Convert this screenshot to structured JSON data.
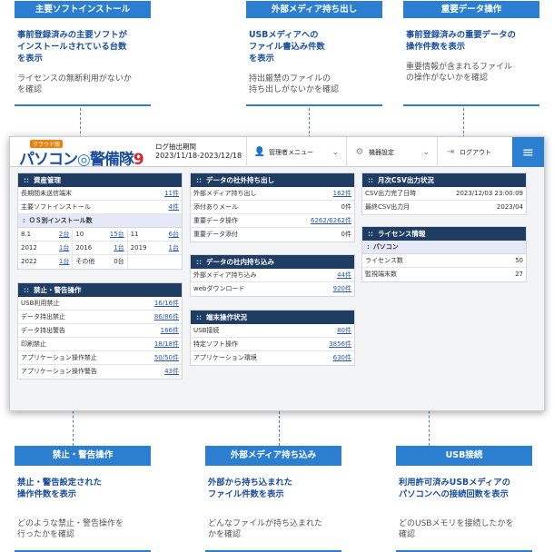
{
  "callouts_top": [
    {
      "header": "主要ソフトインストール",
      "desc": "事前登録済みの主要ソフトが\nインストールされている台数\nを表示",
      "note": "ライセンスの無断利用がないか\nを確認"
    },
    {
      "header": "外部メディア持ち出し",
      "desc": "USBメディアへの\nファイル書込み件数\nを表示",
      "note": "持出厳禁のファイルの\n持ち出しがないかを確認"
    },
    {
      "header": "重要データ操作",
      "desc": "事前登録済みの重要データの\n操作件数を表示",
      "note": "重要情報が含まれるファイル\nの操作がないかを確認"
    }
  ],
  "callouts_bottom": [
    {
      "header": "禁止・警告操作",
      "desc": "禁止・警告設定された\n操作件数を表示",
      "note": "どのような禁止・警告操作を\n行ったかを確認"
    },
    {
      "header": "外部メディア持ち込み",
      "desc": "外部から持ち込まれた\nファイル件数を表示",
      "note": "どんなファイルが持ち込まれた\nかを確認"
    },
    {
      "header": "USB接続",
      "desc": "利用許可済みUSBメディアの\nパソコンへの接続回数を表示",
      "note": "どのUSBメモリを接続したかを\n確認"
    }
  ],
  "app": {
    "logo_small": "クラウド版",
    "logo_main": "パソコン",
    "logo_sub": "警備隊",
    "logo_ver": "9",
    "period_label": "ログ抽出期間",
    "period_value": "2023/11/18-2023/12/18",
    "menu_admin": "管理者メニュー",
    "menu_device": "機器設定",
    "menu_logout": "ログアウト"
  },
  "panels": {
    "asset": {
      "title": "資産管理",
      "rows": [
        {
          "label": "長期間未送信端末",
          "value": "11件"
        },
        {
          "label": "主要ソフトインストール",
          "value": "4件"
        }
      ],
      "os_title": "ＯＳ別インストール数",
      "os_grid": [
        [
          {
            "k": "8.1",
            "v": "2台"
          },
          {
            "k": "10",
            "v": "15台"
          },
          {
            "k": "11",
            "v": "6台"
          }
        ],
        [
          {
            "k": "2012",
            "v": "1台"
          },
          {
            "k": "2016",
            "v": "1台"
          },
          {
            "k": "2019",
            "v": "1台"
          }
        ],
        [
          {
            "k": "2022",
            "v": "1台"
          },
          {
            "k": "その他",
            "v": "0台"
          },
          {
            "k": "",
            "v": ""
          }
        ]
      ]
    },
    "prohibit": {
      "title": "禁止・警告操作",
      "rows": [
        {
          "label": "USB利用禁止",
          "value": "16/16件"
        },
        {
          "label": "データ持出禁止",
          "value": "86/86件"
        },
        {
          "label": "データ持出警告",
          "value": "166件"
        },
        {
          "label": "印刷禁止",
          "value": "18/18件"
        },
        {
          "label": "アプリケーション操作禁止",
          "value": "50/50件"
        },
        {
          "label": "アプリケーション操作警告",
          "value": "43件"
        }
      ]
    },
    "export": {
      "title": "データの社外持ち出し",
      "rows": [
        {
          "label": "外部メディア持ち出し",
          "value": "162件",
          "link": true
        },
        {
          "label": "添付ありメール",
          "value": "0件",
          "link": false
        },
        {
          "label": "重要データ操作",
          "value": "6262/6262件",
          "link": true
        },
        {
          "label": "重要データ添付",
          "value": "0件",
          "link": false
        }
      ]
    },
    "import": {
      "title": "データの社内持ち込み",
      "rows": [
        {
          "label": "外部メディア持ち込み",
          "value": "44件"
        },
        {
          "label": "webダウンロード",
          "value": "920件"
        }
      ]
    },
    "terminal": {
      "title": "端末操作状況",
      "rows": [
        {
          "label": "USB接続",
          "value": "80件"
        },
        {
          "label": "特定ソフト操作",
          "value": "3856件"
        },
        {
          "label": "アプリケーション環境",
          "value": "630件"
        }
      ]
    },
    "csv": {
      "title": "月次CSV出力状況",
      "rows": [
        {
          "label": "CSV出力完了日時",
          "value": "2023/12/03 23:00:09"
        },
        {
          "label": "最終CSV出力月",
          "value": "2023/04"
        }
      ]
    },
    "license": {
      "title": "ライセンス情報",
      "sub": "パソコン",
      "rows": [
        {
          "label": "ライセンス数",
          "value": "50"
        },
        {
          "label": "監視端末数",
          "value": "27"
        }
      ]
    }
  }
}
